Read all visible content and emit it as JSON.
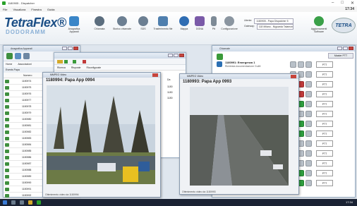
{
  "window": {
    "title": "1180905 - Dispatcher"
  },
  "menu": {
    "items": [
      "File",
      "Visualizza",
      "Finestra",
      "Guida"
    ],
    "clock": "17:34"
  },
  "toolbar": {
    "logo_main": "TetraFlex®",
    "logo_sub": "DODORAMM",
    "buttons": [
      {
        "label": "Anagrafica Apparati",
        "icon": "devices-icon",
        "color": "#3a86c8"
      },
      {
        "label": "Chiamata",
        "icon": "call-icon",
        "color": "#5b6d7e"
      },
      {
        "label": "Storico chiamate",
        "icon": "history-icon",
        "color": "#6c7f92"
      },
      {
        "label": "SDS",
        "icon": "sds-icon",
        "color": "#6c7f92"
      },
      {
        "label": "Trasferimento file",
        "icon": "file-transfer-icon",
        "color": "#4f7fae"
      },
      {
        "label": "Mappa",
        "icon": "map-icon",
        "color": "#2f6db3"
      },
      {
        "label": "DGNA",
        "icon": "dgna-icon",
        "color": "#7a5aa8"
      },
      {
        "label": "Ptt",
        "icon": "ptt-icon",
        "color": "#7d8a96"
      },
      {
        "label": "Configurazione",
        "icon": "settings-icon",
        "color": "#8a95a0"
      }
    ],
    "user_label": "Utente:",
    "user_value": "1180905 - Papa Dispatcher 5",
    "gateway_label": "Gateway:",
    "gateway_value": "118 Milano - Niguarda Talamone",
    "update_label": "Aggiornamenti Software",
    "right_logo": "TETRA"
  },
  "left_panel": {
    "title": "Anagrafica Apparati",
    "tabs": [
      "Home",
      "Associazioni"
    ],
    "tab3": "Events Papa",
    "column": "Numero",
    "rows": [
      "1180974",
      "1180975",
      "1180976",
      "1180977",
      "1180978",
      "1180979",
      "1180980",
      "1180981",
      "1180982",
      "1180983",
      "1180984",
      "1180985",
      "1180986",
      "1180987",
      "1180988",
      "1180989",
      "1180990",
      "1180991",
      "1180992",
      "1180993"
    ]
  },
  "mid_panel": {
    "tabs": [
      "Ricerca",
      "Risposte",
      "Riconfigurate"
    ],
    "col": "Da",
    "ids": [
      "1180",
      "1180",
      "1180"
    ]
  },
  "video1": {
    "title_bar": "MMPEG Video",
    "heading": "1180994:  Papa App 0994",
    "status": "Ottenimento video da 1180994"
  },
  "video2": {
    "title_bar": "MMPEG Video",
    "heading": "1180993:  Papa App 0993",
    "status": "Ottenimento video da 1180993"
  },
  "right_panel": {
    "title": "Chiamate",
    "header_btn": "Master PTT",
    "call_title": "1180991:  Emergenza 1",
    "call_sub": "Richiesta documentazione GuiM",
    "ptt_label": "PTT",
    "rows": 13
  },
  "taskbar": {
    "time": "17:34"
  }
}
